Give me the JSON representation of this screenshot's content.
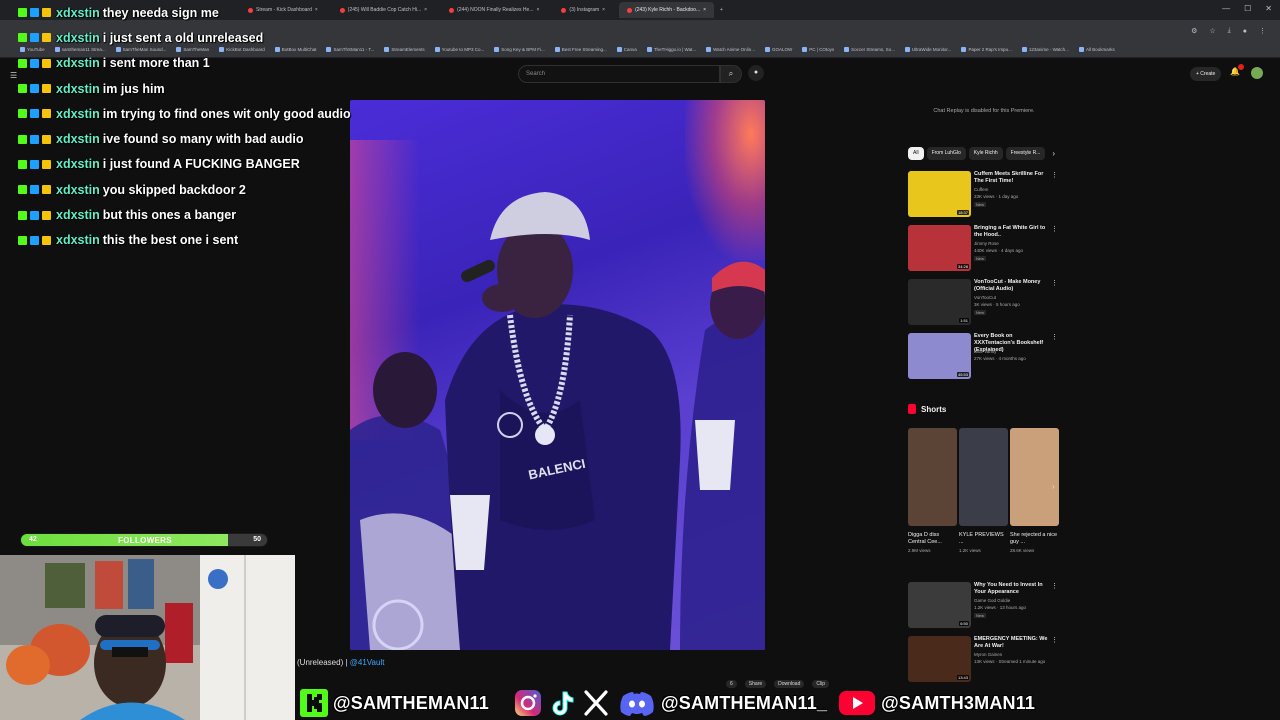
{
  "browser": {
    "tabs": [
      {
        "label": "Stream - Kick Dashboard",
        "active": false
      },
      {
        "label": "(245) Will Baddie Cop Catch Hi...",
        "active": false
      },
      {
        "label": "(244) NOON Finally Realizes He...",
        "active": false
      },
      {
        "label": "(3) Instagram",
        "active": false
      },
      {
        "label": "(243) Kyle Richh - Backdoo...",
        "active": true
      }
    ],
    "bookmarks": [
      "YouTube",
      "samtheman11 Strea...",
      "SamTheMan Sound...",
      "SamTheMan",
      "KickBot Dashboard",
      "BotBox MultiChat",
      "SamThSMan11 - T...",
      "StreamElements",
      "Youtube to MP3 Co...",
      "Song Key & BPM Fi...",
      "Best Free Streaming...",
      "Canva",
      "TheTHiggo.io | Wat...",
      "Watch Anime Onlin...",
      "GOALOW",
      "PC | COtoys",
      "Soccer Streams, So...",
      "UltraWide Monitor...",
      "Paper 2 Rap's Impu...",
      "123anime - Watch...",
      "All Bookmarks"
    ]
  },
  "youtube_header": {
    "search_placeholder": "Search",
    "create_label": "+ Create"
  },
  "video": {
    "title_prefix": "(Unreleased) |",
    "title_channel": "@41Vault",
    "actions": [
      "6",
      "Share",
      "Download",
      "Clip"
    ]
  },
  "sidebar": {
    "chat_notice": "Chat Replay is disabled for this Premiere.",
    "chips": [
      "All",
      "From LuhGlo",
      "Kyle Richh",
      "Freestyle R..."
    ],
    "recommendations": [
      {
        "title": "Cuffem Meets Skrilline For The First Time!",
        "channel": "Cuffem",
        "meta": "23K views · 1 day ago",
        "badge": "New",
        "duration": "18:37",
        "thumb_color": "#e8c61c"
      },
      {
        "title": "Bringing a Fat White Girl to the Hood..",
        "channel": "Jimmy Rose",
        "meta": "440K views · 4 days ago",
        "badge": "New",
        "duration": "34:28",
        "thumb_color": "#b8323a"
      },
      {
        "title": "VonTooCut - Make Money (Official Audio)",
        "channel": "VonTooCut",
        "meta": "3K views · 5 hours ago",
        "badge": "New",
        "duration": "1:51",
        "thumb_color": "#2a2a2a"
      },
      {
        "title": "Every Book on XXXTentacion's Bookshelf (Explained)",
        "channel": "Blue Vanity",
        "meta": "27K views · 4 months ago",
        "badge": "",
        "duration": "45:53",
        "thumb_color": "#8e8ad0"
      }
    ],
    "shorts_title": "Shorts",
    "shorts": [
      {
        "title": "Digga D diss Central Cee...",
        "meta": "2.9M views",
        "thumb_color": "#5b4335"
      },
      {
        "title": "KYLE PREVIEWS ...",
        "meta": "1.2K views",
        "thumb_color": "#3b3d48"
      },
      {
        "title": "She rejected a nice guy ...",
        "meta": "28.6K views",
        "thumb_color": "#c9a07a"
      }
    ],
    "more_recommendations": [
      {
        "title": "Why You Need to Invest In Your Appearance",
        "channel": "Game God Goldie",
        "meta": "1.2K views · 13 hours ago",
        "badge": "New",
        "duration": "6:50",
        "thumb_color": "#3b3b3b"
      },
      {
        "title": "EMERGENCY MEETING: We Are At War!",
        "channel": "Myron Gaines",
        "meta": "13K views · Streamed 1 minute ago",
        "badge": "",
        "duration": "13:43",
        "thumb_color": "#4a2a1a"
      }
    ]
  },
  "chat": [
    {
      "user": "xdxstin",
      "message": "they needa sign me"
    },
    {
      "user": "xdxstin",
      "message": "i just sent a old unreleased"
    },
    {
      "user": "xdxstin",
      "message": "i sent more than 1"
    },
    {
      "user": "xdxstin",
      "message": "im jus him"
    },
    {
      "user": "xdxstin",
      "message": "im trying to find ones wit only good audio"
    },
    {
      "user": "xdxstin",
      "message": "ive found so many with bad audio"
    },
    {
      "user": "xdxstin",
      "message": "i just found A FUCKING BANGER"
    },
    {
      "user": "xdxstin",
      "message": "you skipped backdoor 2"
    },
    {
      "user": "xdxstin",
      "message": "but this ones a banger"
    },
    {
      "user": "xdxstin",
      "message": "this the best one i sent"
    }
  ],
  "followers_goal": {
    "current": "42",
    "label": "FOLLOWERS",
    "goal": "50",
    "progress": 0.84
  },
  "socials": {
    "kick_handle": "@SAMTHEMAN11",
    "meta_handle": "@SAMTHEMAN11_",
    "youtube_handle": "@SAMTH3MAN11"
  },
  "colors": {
    "chat_user": "#5ff0c7",
    "kick_green": "#53fc18",
    "progress_fill": "#6dde3d",
    "youtube_red": "#ff0033"
  }
}
